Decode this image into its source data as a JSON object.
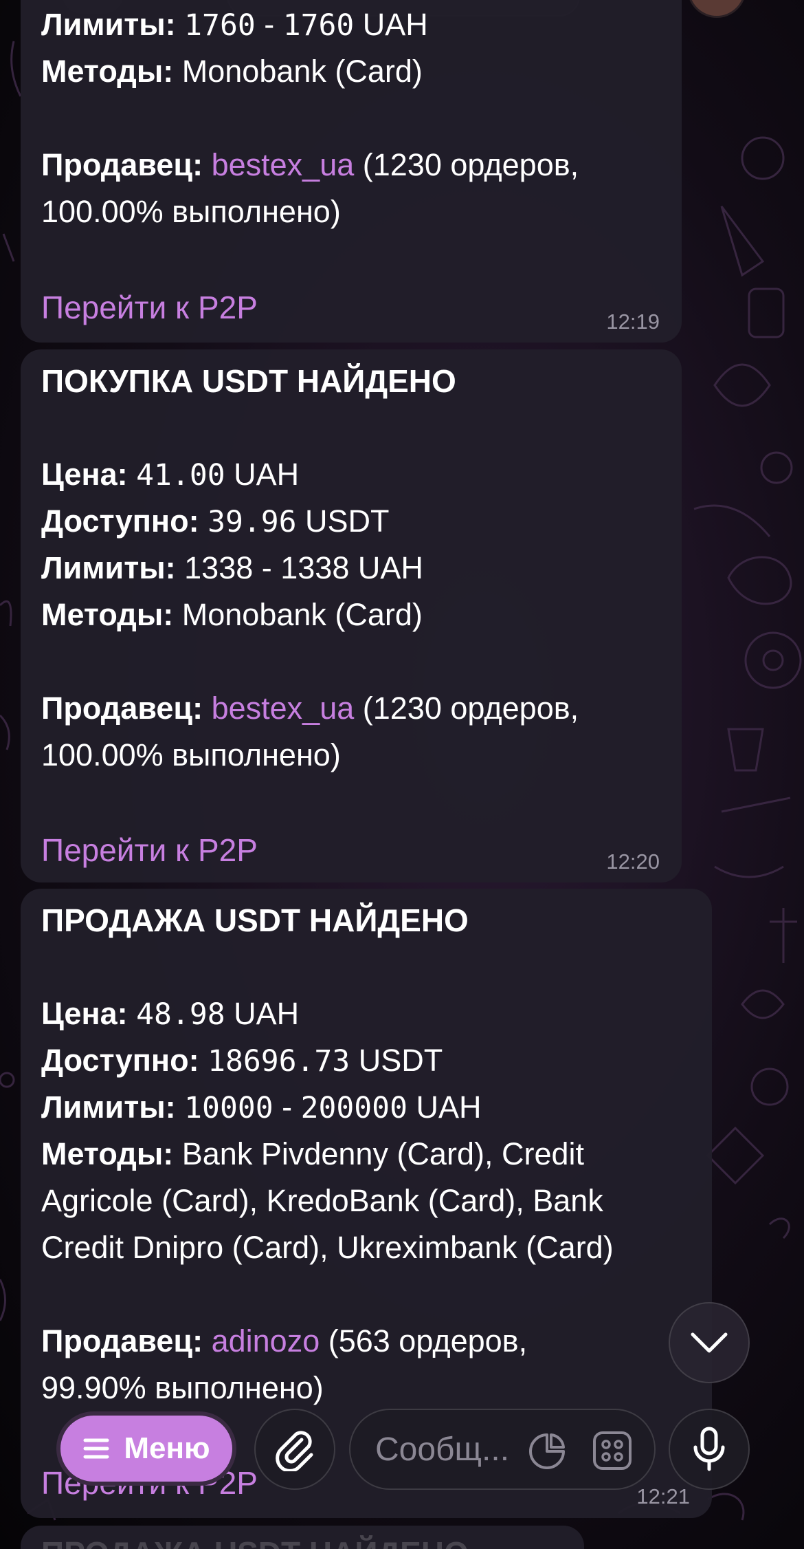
{
  "messages": [
    {
      "partial_lines": [
        {
          "label": "Лимиты:",
          "value_min": "1760",
          "dash": " - ",
          "value_max": "1760",
          "unit": " UAH"
        },
        {
          "label": "Методы:",
          "value": " Monobank (Card)"
        }
      ],
      "seller_label": "Продавец:",
      "seller_name": "bestex_ua",
      "seller_stats_1": " (1230 ордеров,",
      "seller_stats_2": "100.00% выполнено)",
      "link": "Перейти к P2P",
      "time": "12:19"
    },
    {
      "title": "ПОКУПКА USDT НАЙДЕНО",
      "price_label": "Цена:",
      "price_value": "41.00",
      "price_unit": " UAH",
      "avail_label": "Доступно:",
      "avail_value": "39.96",
      "avail_unit": " USDT",
      "limits_label": "Лимиты:",
      "limits_value": " 1338 - 1338 UAH",
      "methods_label": "Методы:",
      "methods_value": " Monobank (Card)",
      "seller_label": "Продавец:",
      "seller_name": "bestex_ua",
      "seller_stats_1": " (1230 ордеров,",
      "seller_stats_2": "100.00% выполнено)",
      "link": "Перейти к P2P",
      "time": "12:20"
    },
    {
      "title": "ПРОДАЖА USDT НАЙДЕНО",
      "price_label": "Цена:",
      "price_value": "48.98",
      "price_unit": " UAH",
      "avail_label": "Доступно:",
      "avail_value": "18696.73",
      "avail_unit": " USDT",
      "limits_label": "Лимиты:",
      "limits_min": "10000",
      "limits_dash": " - ",
      "limits_max": "200000",
      "limits_unit": " UAH",
      "methods_label": "Методы:",
      "methods_line_1": " Bank Pivdenny (Card), Credit",
      "methods_line_2": "Agricole (Card), KredoBank (Card), Bank",
      "methods_line_3": "Credit Dnipro (Card), Ukreximbank (Card)",
      "seller_label": "Продавец:",
      "seller_name": "adinozo",
      "seller_stats_1": " (563 ордеров,",
      "seller_stats_2": "99.90% выполнено)",
      "link": "Перейти к P2P",
      "time": "12:21"
    },
    {
      "title": "ПРОДАЖА USDT НАЙДЕНО"
    }
  ],
  "input_bar": {
    "menu_label": "Меню",
    "placeholder": "Сообщ..."
  },
  "colors": {
    "accent": "#c77fe0",
    "bubble": "#211e2a",
    "time": "#9a96a4"
  },
  "icons": [
    "chevron-down-icon",
    "hamburger-icon",
    "paperclip-icon",
    "sticker-icon",
    "keyboard-icon",
    "microphone-icon"
  ]
}
